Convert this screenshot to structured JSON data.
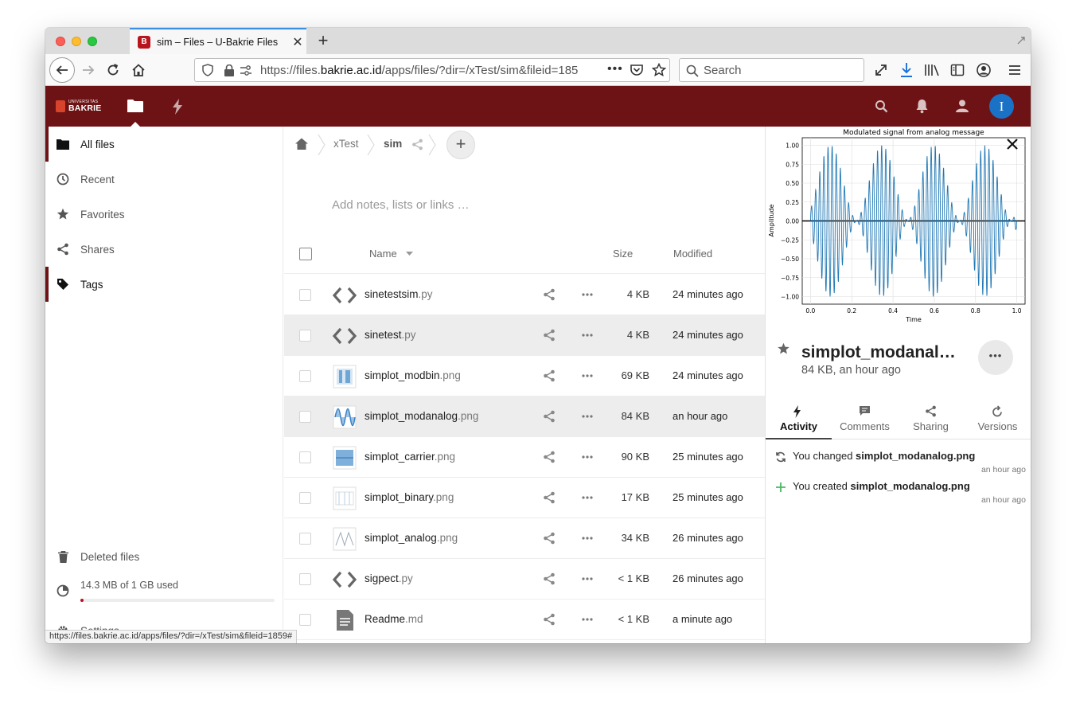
{
  "browser": {
    "tab_title": "sim – Files – U-Bakrie Files",
    "url_prefix": "https://files.",
    "url_domain": "bakrie.ac.id",
    "url_rest": "/apps/files/?dir=/xTest/sim&fileid=185",
    "search_placeholder": "Search",
    "status_url": "https://files.bakrie.ac.id/apps/files/?dir=/xTest/sim&fileid=1859#"
  },
  "header": {
    "logo_small": "UNIVERSITAS",
    "logo_text": "BAKRIE",
    "avatar_letter": "I",
    "color": "#6e1315"
  },
  "sidebar": {
    "items": [
      {
        "label": "All files"
      },
      {
        "label": "Recent"
      },
      {
        "label": "Favorites"
      },
      {
        "label": "Shares"
      },
      {
        "label": "Tags"
      }
    ],
    "deleted": "Deleted files",
    "quota": "14.3 MB of 1 GB used",
    "quota_fraction": 0.014,
    "settings": "Settings"
  },
  "main": {
    "crumbs": [
      "xTest",
      "sim"
    ],
    "notes_placeholder": "Add notes, lists or links …",
    "col_name": "Name",
    "col_size": "Size",
    "col_modified": "Modified",
    "files": [
      {
        "base": "sinetestsim",
        "ext": ".py",
        "size": "4 KB",
        "modified": "24 minutes ago",
        "icon": "code-icon"
      },
      {
        "base": "sinetest",
        "ext": ".py",
        "size": "4 KB",
        "modified": "24 minutes ago",
        "icon": "code-icon"
      },
      {
        "base": "simplot_modbin",
        "ext": ".png",
        "size": "69 KB",
        "modified": "24 minutes ago",
        "icon": "image-thumb"
      },
      {
        "base": "simplot_modanalog",
        "ext": ".png",
        "size": "84 KB",
        "modified": "an hour ago",
        "icon": "image-thumb"
      },
      {
        "base": "simplot_carrier",
        "ext": ".png",
        "size": "90 KB",
        "modified": "25 minutes ago",
        "icon": "image-thumb"
      },
      {
        "base": "simplot_binary",
        "ext": ".png",
        "size": "17 KB",
        "modified": "25 minutes ago",
        "icon": "image-thumb"
      },
      {
        "base": "simplot_analog",
        "ext": ".png",
        "size": "34 KB",
        "modified": "26 minutes ago",
        "icon": "image-thumb"
      },
      {
        "base": "sigpect",
        "ext": ".py",
        "size": "< 1 KB",
        "modified": "26 minutes ago",
        "icon": "code-icon"
      },
      {
        "base": "Readme",
        "ext": ".md",
        "size": "< 1 KB",
        "modified": "a minute ago",
        "icon": "text-file-icon"
      }
    ]
  },
  "details": {
    "preview_title": "Modulated signal from analog message",
    "preview_xlabel": "Time",
    "preview_ylabel": "Amplitude",
    "preview_yticks": [
      "1.00",
      "0.75",
      "0.50",
      "0.25",
      "0.00",
      "−0.25",
      "−0.50",
      "−0.75",
      "−1.00"
    ],
    "preview_xticks": [
      "0.0",
      "0.2",
      "0.4",
      "0.6",
      "0.8",
      "1.0"
    ],
    "title": "simplot_modanal…",
    "meta": "84 KB, an hour ago",
    "tabs": [
      "Activity",
      "Comments",
      "Sharing",
      "Versions"
    ],
    "activities": [
      {
        "prefix": "You changed ",
        "file": "simplot_modanalog.png",
        "when": "an hour ago"
      },
      {
        "prefix": "You created ",
        "file": "simplot_modanalog.png",
        "when": "an hour ago"
      }
    ]
  }
}
